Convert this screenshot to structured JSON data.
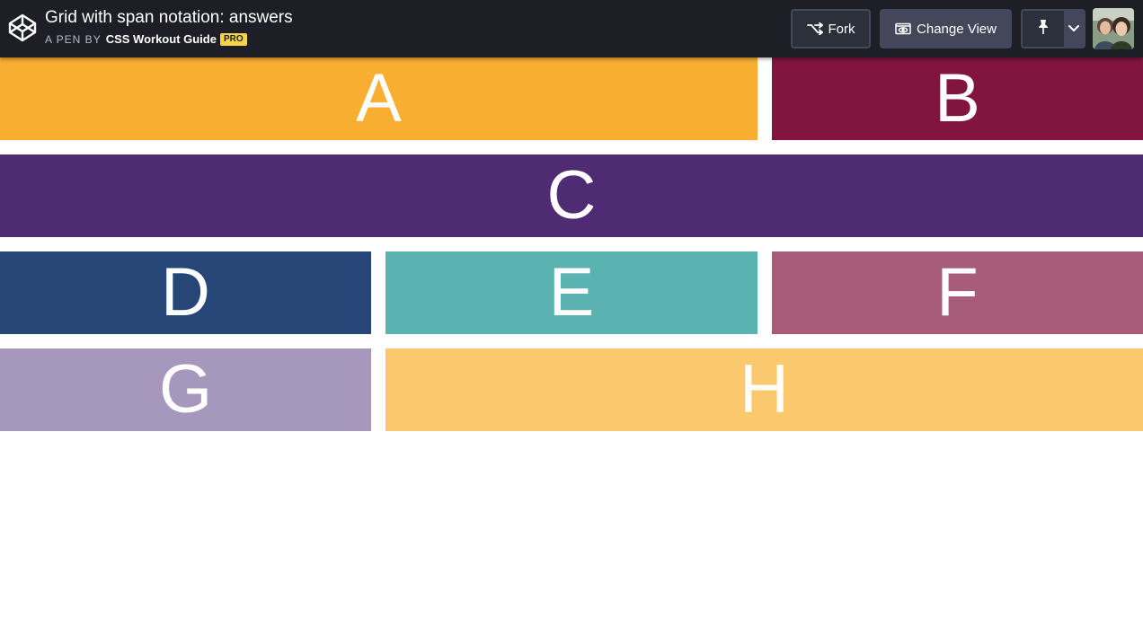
{
  "header": {
    "title": "Grid with span notation: answers",
    "byline_prefix": "A PEN BY",
    "author": "CSS Workout Guide",
    "badge": "PRO",
    "logo_icon": "codepen-logo-icon"
  },
  "actions": {
    "fork_label": "Fork",
    "fork_icon": "fork-icon",
    "change_view_label": "Change View",
    "change_view_icon": "eye-window-icon",
    "pin_icon": "pin-icon",
    "dropdown_icon": "chevron-down-icon",
    "avatar": "user-avatar"
  },
  "grid": {
    "items": [
      {
        "label": "A",
        "color": "#f8ae31"
      },
      {
        "label": "B",
        "color": "#82153f"
      },
      {
        "label": "C",
        "color": "#4e2b72"
      },
      {
        "label": "D",
        "color": "#264677"
      },
      {
        "label": "E",
        "color": "#5ab3b0"
      },
      {
        "label": "F",
        "color": "#a75c7a"
      },
      {
        "label": "G",
        "color": "#a697bc"
      },
      {
        "label": "H",
        "color": "#fac96d"
      }
    ]
  }
}
